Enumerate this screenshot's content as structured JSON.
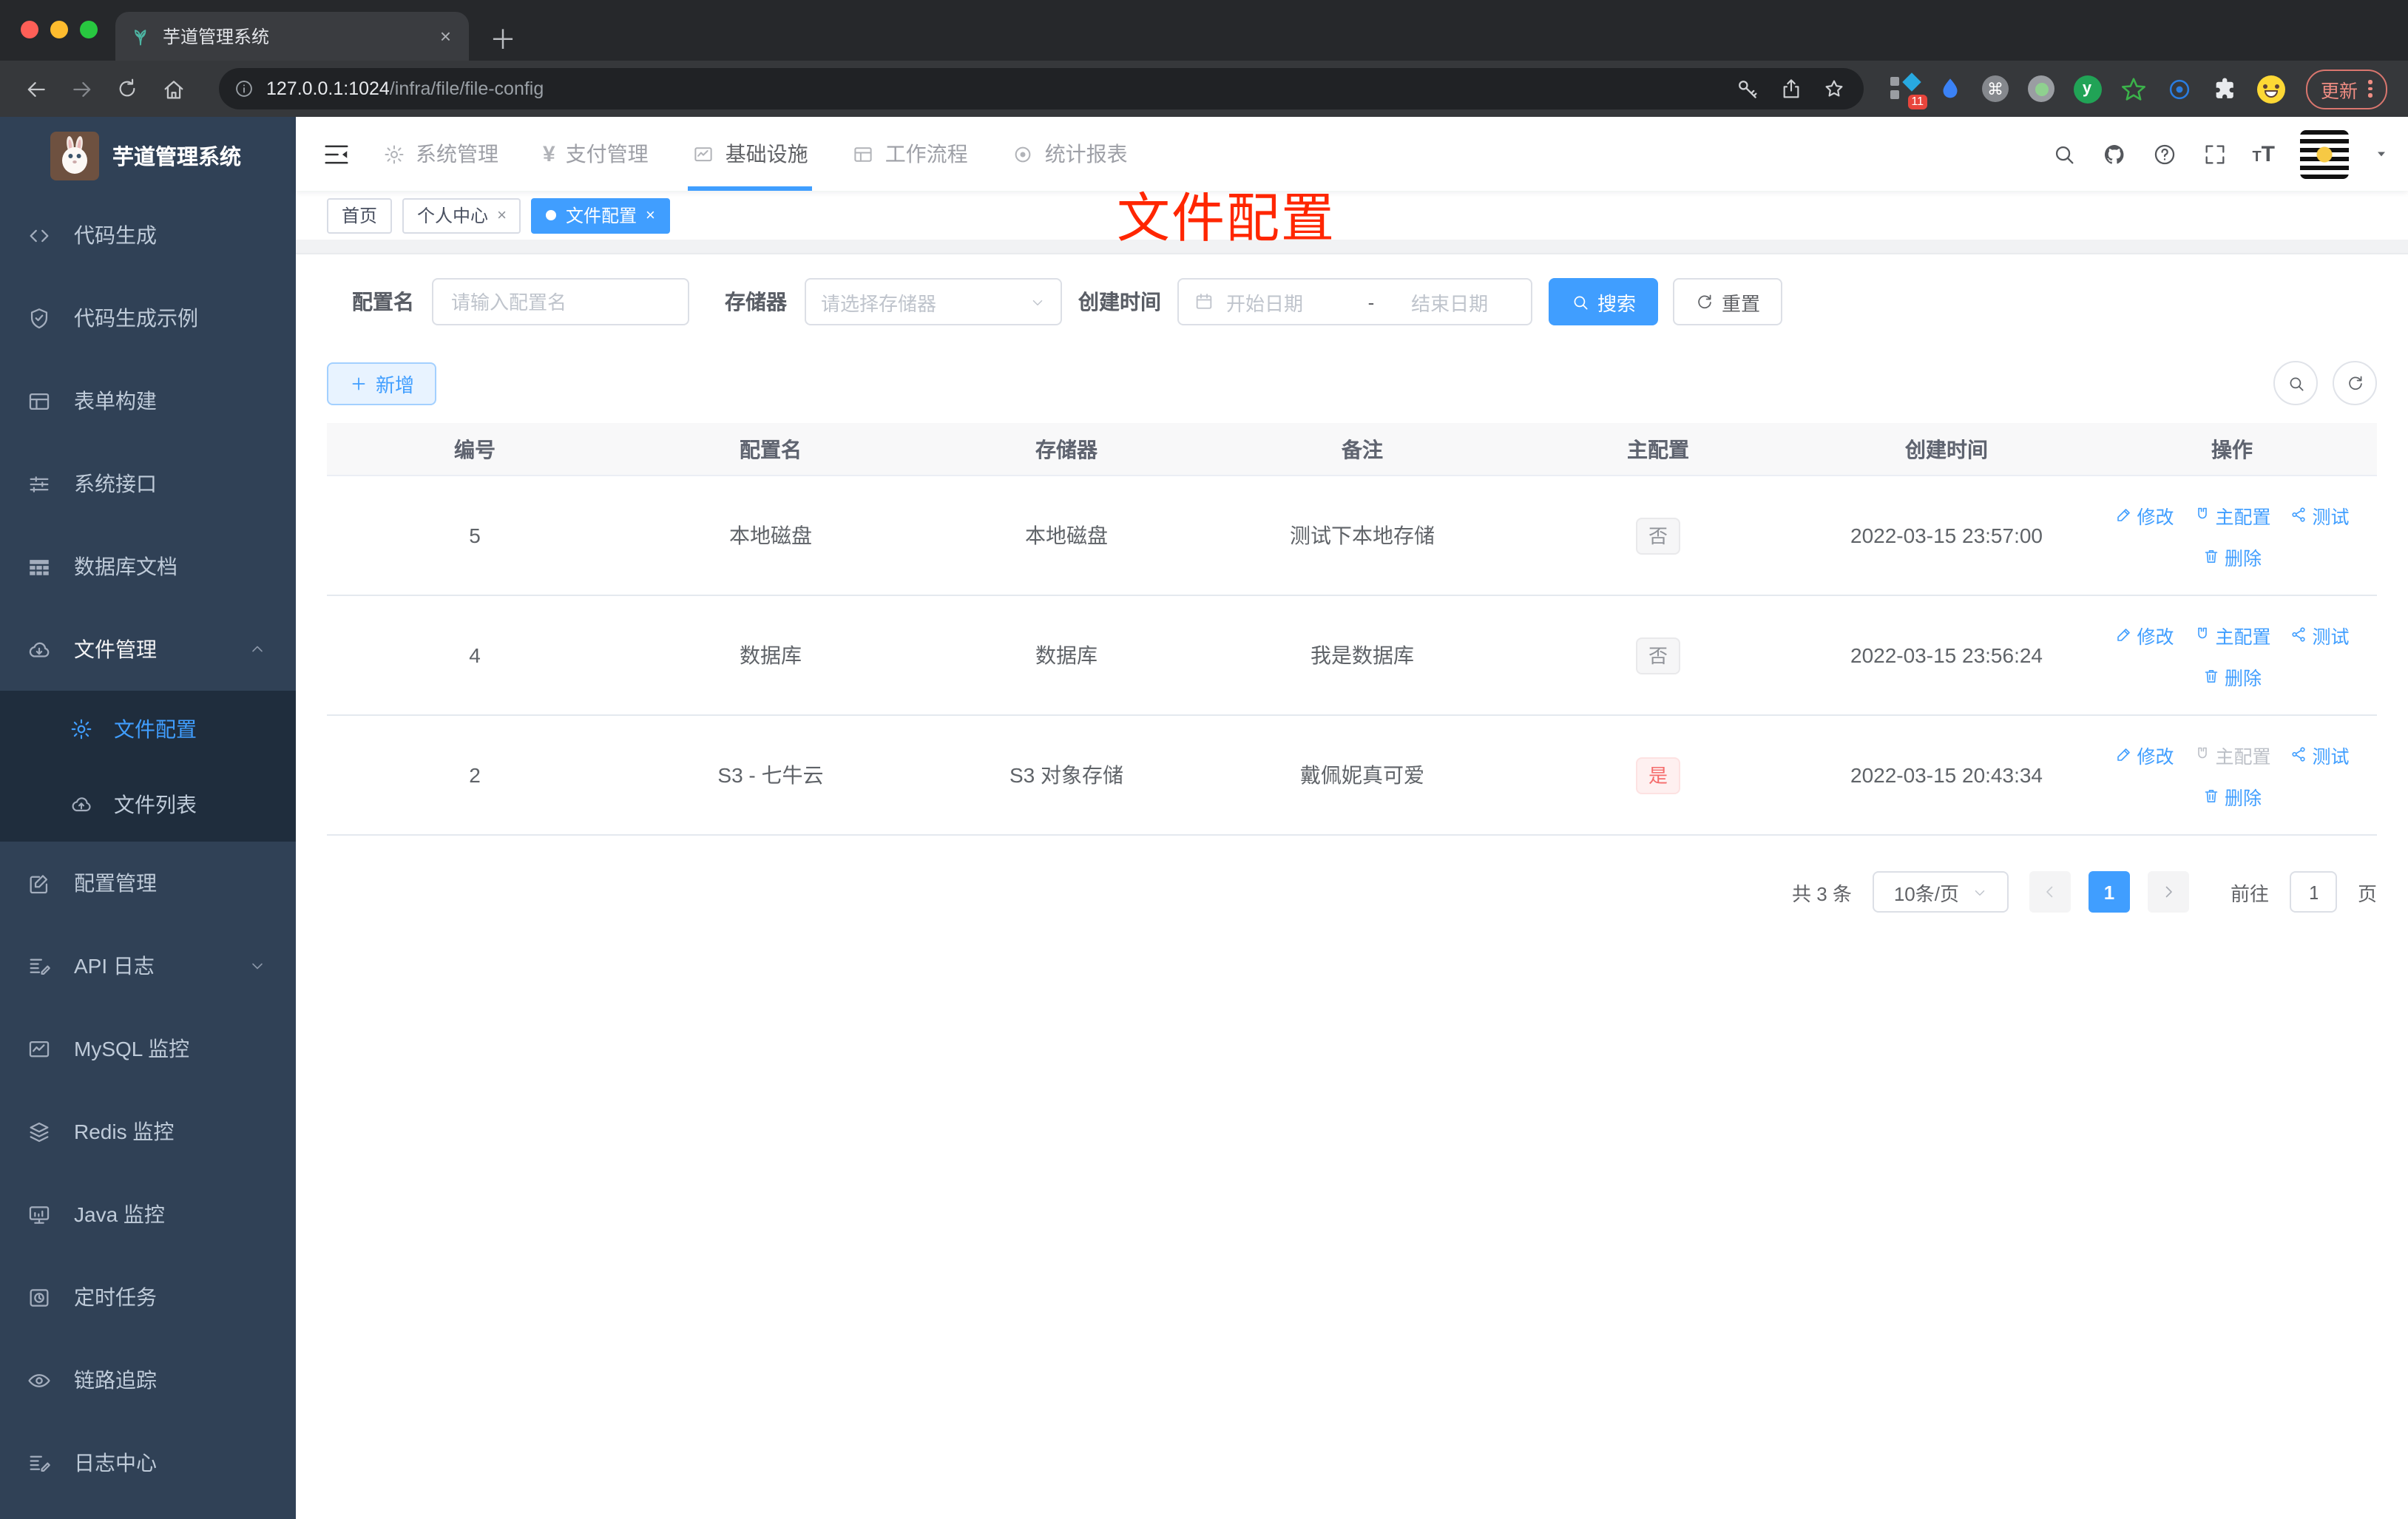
{
  "browser": {
    "tab_title": "芋道管理系统",
    "url_host": "127.0.0.1:1024",
    "url_path": "/infra/file/file-config",
    "ext_badge": "11",
    "update_label": "更新",
    "new_tab_glyph": "＋",
    "close_glyph": "×",
    "traffic_colors": [
      "#ff5f57",
      "#febc2e",
      "#28c840"
    ]
  },
  "sidebar": {
    "title": "芋道管理系统",
    "items": [
      {
        "label": "代码生成",
        "icon": "code-icon"
      },
      {
        "label": "代码生成示例",
        "icon": "shield-check-icon"
      },
      {
        "label": "表单构建",
        "icon": "form-icon"
      },
      {
        "label": "系统接口",
        "icon": "sliders-icon"
      },
      {
        "label": "数据库文档",
        "icon": "table-grid-icon"
      },
      {
        "label": "文件管理",
        "icon": "cloud-download-icon",
        "expanded": true
      },
      {
        "label": "文件配置",
        "icon": "gear-icon",
        "active": true
      },
      {
        "label": "文件列表",
        "icon": "cloud-upload-icon"
      },
      {
        "label": "配置管理",
        "icon": "edit-square-icon"
      },
      {
        "label": "API 日志",
        "icon": "doc-edit-icon",
        "collapsed": true
      },
      {
        "label": "MySQL 监控",
        "icon": "chart-icon"
      },
      {
        "label": "Redis 监控",
        "icon": "layers-icon"
      },
      {
        "label": "Java 监控",
        "icon": "monitor-icon"
      },
      {
        "label": "定时任务",
        "icon": "clock-icon"
      },
      {
        "label": "链路追踪",
        "icon": "eye-icon"
      },
      {
        "label": "日志中心",
        "icon": "doc-edit-icon"
      }
    ]
  },
  "topnav": {
    "items": [
      "系统管理",
      "支付管理",
      "基础设施",
      "工作流程",
      "统计报表"
    ],
    "active": "基础设施"
  },
  "tags": {
    "home": "首页",
    "profile": "个人中心",
    "current": "文件配置"
  },
  "annotation": "文件配置",
  "filter": {
    "name_label": "配置名",
    "name_placeholder": "请输入配置名",
    "storage_label": "存储器",
    "storage_placeholder": "请选择存储器",
    "time_label": "创建时间",
    "start_placeholder": "开始日期",
    "separator": "-",
    "end_placeholder": "结束日期",
    "search": "搜索",
    "reset": "重置"
  },
  "toolbar": {
    "add": "新增"
  },
  "table": {
    "headers": [
      "编号",
      "配置名",
      "存储器",
      "备注",
      "主配置",
      "创建时间",
      "操作"
    ],
    "actions": {
      "edit": "修改",
      "master": "主配置",
      "test": "测试",
      "delete": "删除"
    },
    "rows": [
      {
        "id": "5",
        "name": "本地磁盘",
        "storage": "本地磁盘",
        "remark": "测试下本地存储",
        "master": "否",
        "time": "2022-03-15 23:57:00"
      },
      {
        "id": "4",
        "name": "数据库",
        "storage": "数据库",
        "remark": "我是数据库",
        "master": "否",
        "time": "2022-03-15 23:56:24"
      },
      {
        "id": "2",
        "name": "S3 - 七牛云",
        "storage": "S3 对象存储",
        "remark": "戴佩妮真可爱",
        "master": "是",
        "time": "2022-03-15 20:43:34"
      }
    ]
  },
  "pagination": {
    "total": "共 3 条",
    "page_size": "10条/页",
    "page": "1",
    "goto": "前往",
    "goto_value": "1",
    "page_unit": "页"
  },
  "colors": {
    "primary": "#409eff",
    "danger": "#f56c6c",
    "sidebar_bg": "#304156",
    "submenu_bg": "#1f2d3d",
    "annotation_red": "#ff2600"
  }
}
